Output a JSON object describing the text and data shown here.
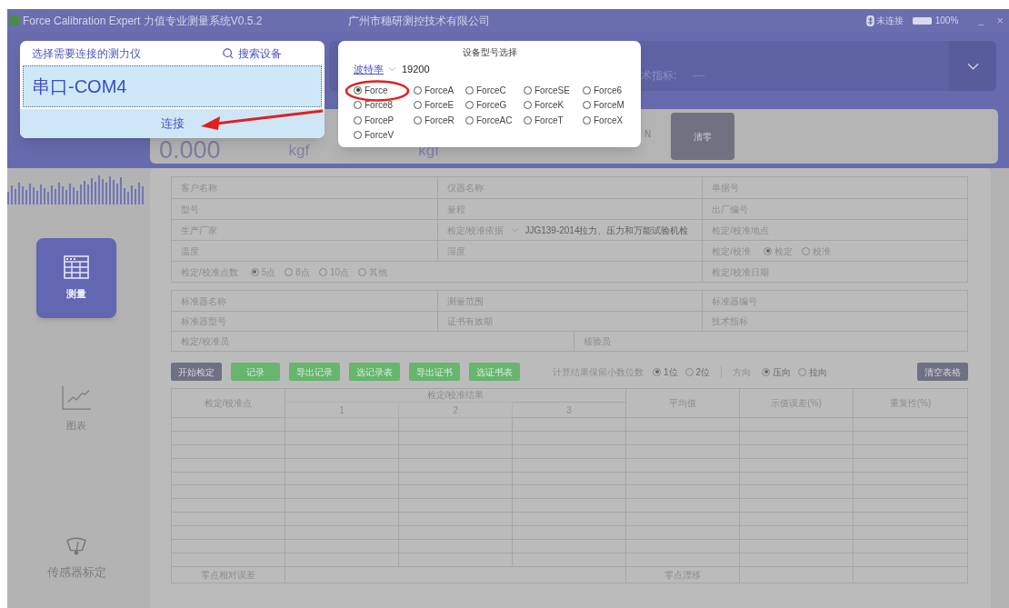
{
  "title_bar": {
    "title": "Force Calibration Expert 力值专业测量系统V0.5.2",
    "company": "广州市穗研测控技术有限公司",
    "bluetooth": "未连接",
    "battery": "100%",
    "minimize": "_",
    "close": "×"
  },
  "device_panel": {
    "spec_label": "术指标:",
    "spec_value": "----"
  },
  "readout": {
    "value": "0.000",
    "unit": "kgf",
    "unit_2": "kgf",
    "unit_option": "N",
    "zero_button": "清零"
  },
  "sidebar": {
    "items": [
      {
        "label": "测量",
        "kind": "table",
        "selected": true
      },
      {
        "label": "图表",
        "kind": "chart",
        "selected": false
      },
      {
        "label": "传感器标定",
        "kind": "gauge",
        "selected": false
      }
    ]
  },
  "form": {
    "sections": [
      {
        "rows": [
          [
            {
              "kind": "field",
              "label": "客户名称"
            },
            {
              "kind": "field",
              "label": "仪器名称"
            },
            {
              "kind": "field",
              "label": "单据号"
            }
          ],
          [
            {
              "kind": "field",
              "label": "型号"
            },
            {
              "kind": "field",
              "label": "量程"
            },
            {
              "kind": "field",
              "label": "出厂编号"
            }
          ],
          [
            {
              "kind": "field",
              "label": "生产厂家"
            },
            {
              "kind": "select",
              "label": "检定/校准依据",
              "value": "JJG139-2014拉力、压力和万能试验机检"
            },
            {
              "kind": "field",
              "label": "检定/校准地点"
            }
          ],
          [
            {
              "kind": "field",
              "label": "温度"
            },
            {
              "kind": "field",
              "label": "湿度"
            },
            {
              "kind": "radio",
              "label": "检定/校准",
              "options": [
                {
                  "label": "检定",
                  "selected": true
                },
                {
                  "label": "校准",
                  "selected": false
                }
              ]
            }
          ],
          [
            {
              "kind": "radio",
              "label": "检定/校准点数",
              "options": [
                {
                  "label": "5点",
                  "selected": true
                },
                {
                  "label": "8点",
                  "selected": false
                },
                {
                  "label": "10点",
                  "selected": false
                },
                {
                  "label": "其他",
                  "selected": false
                }
              ]
            },
            {
              "kind": "empty"
            },
            {
              "kind": "field",
              "label": "检定/校准日期"
            }
          ]
        ]
      },
      {
        "rows": [
          [
            {
              "kind": "field",
              "label": "标准器名称"
            },
            {
              "kind": "field",
              "label": "测量范围"
            },
            {
              "kind": "field",
              "label": "标准器编号"
            }
          ],
          [
            {
              "kind": "field",
              "label": "标准器型号"
            },
            {
              "kind": "field",
              "label": "证书有效期"
            },
            {
              "kind": "field",
              "label": "技术指标"
            }
          ],
          [
            {
              "kind": "field",
              "label": "检定/校准员"
            },
            {
              "kind": "field",
              "label": "核验员"
            }
          ]
        ]
      }
    ]
  },
  "toolbar": {
    "buttons": [
      {
        "label": "开始检定",
        "kind": "dark"
      },
      {
        "label": "记录",
        "kind": "green"
      },
      {
        "label": "导出记录",
        "kind": "green"
      },
      {
        "label": "选记录表",
        "kind": "green"
      },
      {
        "label": "导出证书",
        "kind": "green"
      },
      {
        "label": "选证书表",
        "kind": "green"
      }
    ],
    "decimals_label": "计算结果保留小数位数",
    "decimals": [
      {
        "label": "1位",
        "selected": true
      },
      {
        "label": "2位",
        "selected": false
      }
    ],
    "direction_label": "方向",
    "direction": [
      {
        "label": "压向",
        "selected": true
      },
      {
        "label": "拉向",
        "selected": false
      }
    ],
    "clear_button": "清空表格"
  },
  "table": {
    "point_column": "检定/校准点",
    "result_group": "检定/校准结果",
    "result_columns": [
      "1",
      "2",
      "3"
    ],
    "other_columns": [
      "平均值",
      "示值误差(%)",
      "重复性(%)"
    ],
    "footer": {
      "zero_error": "零点相对误差",
      "zero_drift": "零点漂移"
    }
  },
  "connect_dialog": {
    "title": "选择需要连接的测力仪",
    "search": "搜索设备",
    "devices": [
      {
        "name": "串口-COM4",
        "selected": true
      }
    ],
    "connect": "连接"
  },
  "model_dialog": {
    "title": "设备型号选择",
    "baud_label": "波特率",
    "baud_value": "19200",
    "models": [
      {
        "label": "Force",
        "selected": true
      },
      {
        "label": "ForceA",
        "selected": false
      },
      {
        "label": "ForceC",
        "selected": false
      },
      {
        "label": "ForceSE",
        "selected": false
      },
      {
        "label": "Force6",
        "selected": false
      },
      {
        "label": "Force8",
        "selected": false
      },
      {
        "label": "ForceE",
        "selected": false
      },
      {
        "label": "ForceG",
        "selected": false
      },
      {
        "label": "ForceK",
        "selected": false
      },
      {
        "label": "ForceM",
        "selected": false
      },
      {
        "label": "ForceP",
        "selected": false
      },
      {
        "label": "ForceR",
        "selected": false
      },
      {
        "label": "ForceAC",
        "selected": false
      },
      {
        "label": "ForceT",
        "selected": false
      },
      {
        "label": "ForceX",
        "selected": false
      },
      {
        "label": "ForceV",
        "selected": false
      }
    ]
  }
}
